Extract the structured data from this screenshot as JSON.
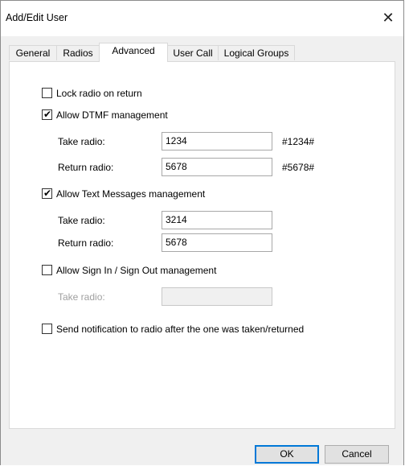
{
  "window": {
    "title": "Add/Edit User",
    "close_glyph": "✕"
  },
  "tabs": [
    {
      "label": "General"
    },
    {
      "label": "Radios"
    },
    {
      "label": "Advanced",
      "active": true
    },
    {
      "label": "User Call"
    },
    {
      "label": "Logical Groups"
    }
  ],
  "advanced": {
    "lock_radio": {
      "label": "Lock radio on return",
      "checked": false
    },
    "dtmf": {
      "label": "Allow DTMF management",
      "checked": true,
      "take_label": "Take radio:",
      "take_value": "1234",
      "take_code": "#1234#",
      "return_label": "Return radio:",
      "return_value": "5678",
      "return_code": "#5678#"
    },
    "text_messages": {
      "label": "Allow Text Messages management",
      "checked": true,
      "take_label": "Take radio:",
      "take_value": "3214",
      "return_label": "Return radio:",
      "return_value": "5678"
    },
    "sign_in_out": {
      "label": "Allow Sign In / Sign Out management",
      "checked": false,
      "take_label": "Take radio:",
      "take_value": ""
    },
    "notify": {
      "label": "Send notification to radio after the one was taken/returned",
      "checked": false
    }
  },
  "buttons": {
    "ok": "OK",
    "cancel": "Cancel"
  }
}
